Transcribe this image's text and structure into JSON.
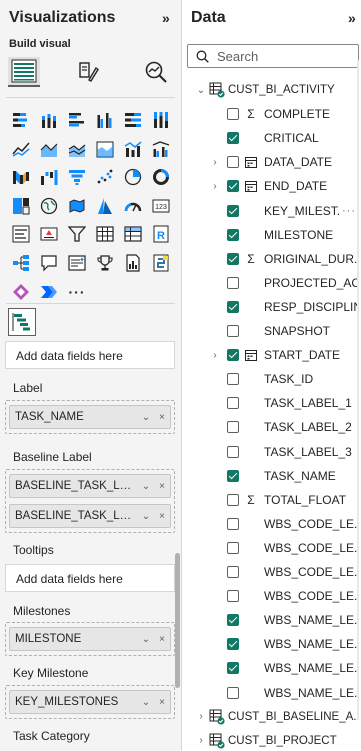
{
  "visualizations": {
    "title": "Visualizations",
    "collapse_glyph": "»",
    "build_visual_label": "Build visual",
    "modes": [
      "build-visual-icon",
      "format-visual-icon",
      "analytics-icon"
    ],
    "more_glyph": "···",
    "selected_visual_icon": "gantt-icon",
    "visual_icons": [
      "stacked-bar-chart-icon",
      "stacked-column-chart-icon",
      "clustered-bar-chart-icon",
      "clustered-column-chart-icon",
      "100-stacked-bar-chart-icon",
      "100-stacked-column-chart-icon",
      "line-chart-icon",
      "area-chart-icon",
      "stacked-area-chart-icon",
      "100-stacked-area-chart-icon",
      "line-and-stacked-column-chart-icon",
      "line-and-clustered-column-chart-icon",
      "ribbon-chart-icon",
      "waterfall-chart-icon",
      "funnel-chart-icon",
      "scatter-chart-icon",
      "pie-chart-icon",
      "donut-chart-icon",
      "treemap-icon",
      "map-icon",
      "filled-map-icon",
      "azure-map-icon",
      "gauge-icon",
      "card-icon",
      "multi-row-card-icon",
      "kpi-icon",
      "slicer-icon",
      "table-icon",
      "matrix-icon",
      "r-visual-icon",
      "decomposition-tree-icon",
      "qa-icon",
      "smart-narrative-icon",
      "trophy-icon",
      "paginated-report-icon",
      "python-visual-icon",
      "power-apps-icon",
      "power-automate-icon"
    ]
  },
  "wells": {
    "top_drop": "Add data fields here",
    "label": {
      "title": "Label",
      "fields": [
        "TASK_NAME"
      ]
    },
    "baseline_label": {
      "title": "Baseline Label",
      "fields": [
        "BASELINE_TASK_LABE...",
        "BASELINE_TASK_LABE..."
      ]
    },
    "tooltips": {
      "title": "Tooltips",
      "placeholder": "Add data fields here"
    },
    "milestones": {
      "title": "Milestones",
      "fields": [
        "MILESTONE"
      ]
    },
    "key_milestone": {
      "title": "Key Milestone",
      "fields": [
        "KEY_MILESTONES"
      ]
    },
    "task_category": {
      "title": "Task Category"
    },
    "pill_dropdown_glyph": "⌄",
    "pill_remove_glyph": "×"
  },
  "data": {
    "title": "Data",
    "collapse_glyph": "»",
    "search": {
      "placeholder": "Search",
      "value": ""
    },
    "tables": [
      {
        "name": "CUST_BI_ACTIVITY",
        "expanded": true,
        "fields": [
          {
            "name": "COMPLETE",
            "checked": false,
            "type": "sigma",
            "expandable": false,
            "more": false
          },
          {
            "name": "CRITICAL",
            "checked": true,
            "type": "none",
            "expandable": false,
            "more": false
          },
          {
            "name": "DATA_DATE",
            "checked": false,
            "type": "calendar",
            "expandable": true,
            "more": false
          },
          {
            "name": "END_DATE",
            "checked": true,
            "type": "calendar",
            "expandable": true,
            "more": false
          },
          {
            "name": "KEY_MILEST...",
            "checked": true,
            "type": "none",
            "expandable": false,
            "more": true
          },
          {
            "name": "MILESTONE",
            "checked": true,
            "type": "none",
            "expandable": false,
            "more": false
          },
          {
            "name": "ORIGINAL_DUR...",
            "checked": true,
            "type": "sigma",
            "expandable": false,
            "more": false
          },
          {
            "name": "PROJECTED_AC...",
            "checked": false,
            "type": "none",
            "expandable": false,
            "more": false
          },
          {
            "name": "RESP_DISCIPLINE",
            "checked": true,
            "type": "none",
            "expandable": false,
            "more": false
          },
          {
            "name": "SNAPSHOT",
            "checked": false,
            "type": "none",
            "expandable": false,
            "more": false
          },
          {
            "name": "START_DATE",
            "checked": true,
            "type": "calendar",
            "expandable": true,
            "more": false
          },
          {
            "name": "TASK_ID",
            "checked": false,
            "type": "none",
            "expandable": false,
            "more": false
          },
          {
            "name": "TASK_LABEL_1",
            "checked": false,
            "type": "none",
            "expandable": false,
            "more": false
          },
          {
            "name": "TASK_LABEL_2",
            "checked": false,
            "type": "none",
            "expandable": false,
            "more": false
          },
          {
            "name": "TASK_LABEL_3",
            "checked": false,
            "type": "none",
            "expandable": false,
            "more": false
          },
          {
            "name": "TASK_NAME",
            "checked": true,
            "type": "none",
            "expandable": false,
            "more": false
          },
          {
            "name": "TOTAL_FLOAT",
            "checked": false,
            "type": "sigma",
            "expandable": false,
            "more": false
          },
          {
            "name": "WBS_CODE_LE...",
            "checked": false,
            "type": "none",
            "expandable": false,
            "more": false
          },
          {
            "name": "WBS_CODE_LE...",
            "checked": false,
            "type": "none",
            "expandable": false,
            "more": false
          },
          {
            "name": "WBS_CODE_LE...",
            "checked": false,
            "type": "none",
            "expandable": false,
            "more": false
          },
          {
            "name": "WBS_CODE_LE...",
            "checked": false,
            "type": "none",
            "expandable": false,
            "more": false
          },
          {
            "name": "WBS_NAME_LE...",
            "checked": true,
            "type": "none",
            "expandable": false,
            "more": false
          },
          {
            "name": "WBS_NAME_LE...",
            "checked": true,
            "type": "none",
            "expandable": false,
            "more": false
          },
          {
            "name": "WBS_NAME_LE...",
            "checked": true,
            "type": "none",
            "expandable": false,
            "more": false
          },
          {
            "name": "WBS_NAME_LE...",
            "checked": false,
            "type": "none",
            "expandable": false,
            "more": false
          }
        ]
      },
      {
        "name": "CUST_BI_BASELINE_A...",
        "expanded": false,
        "fields": []
      },
      {
        "name": "CUST_BI_PROJECT",
        "expanded": false,
        "fields": []
      }
    ]
  },
  "colors": {
    "check_green": "#117865",
    "accent_blue": "#118dff",
    "pane_bg": "#f4f4f4"
  }
}
